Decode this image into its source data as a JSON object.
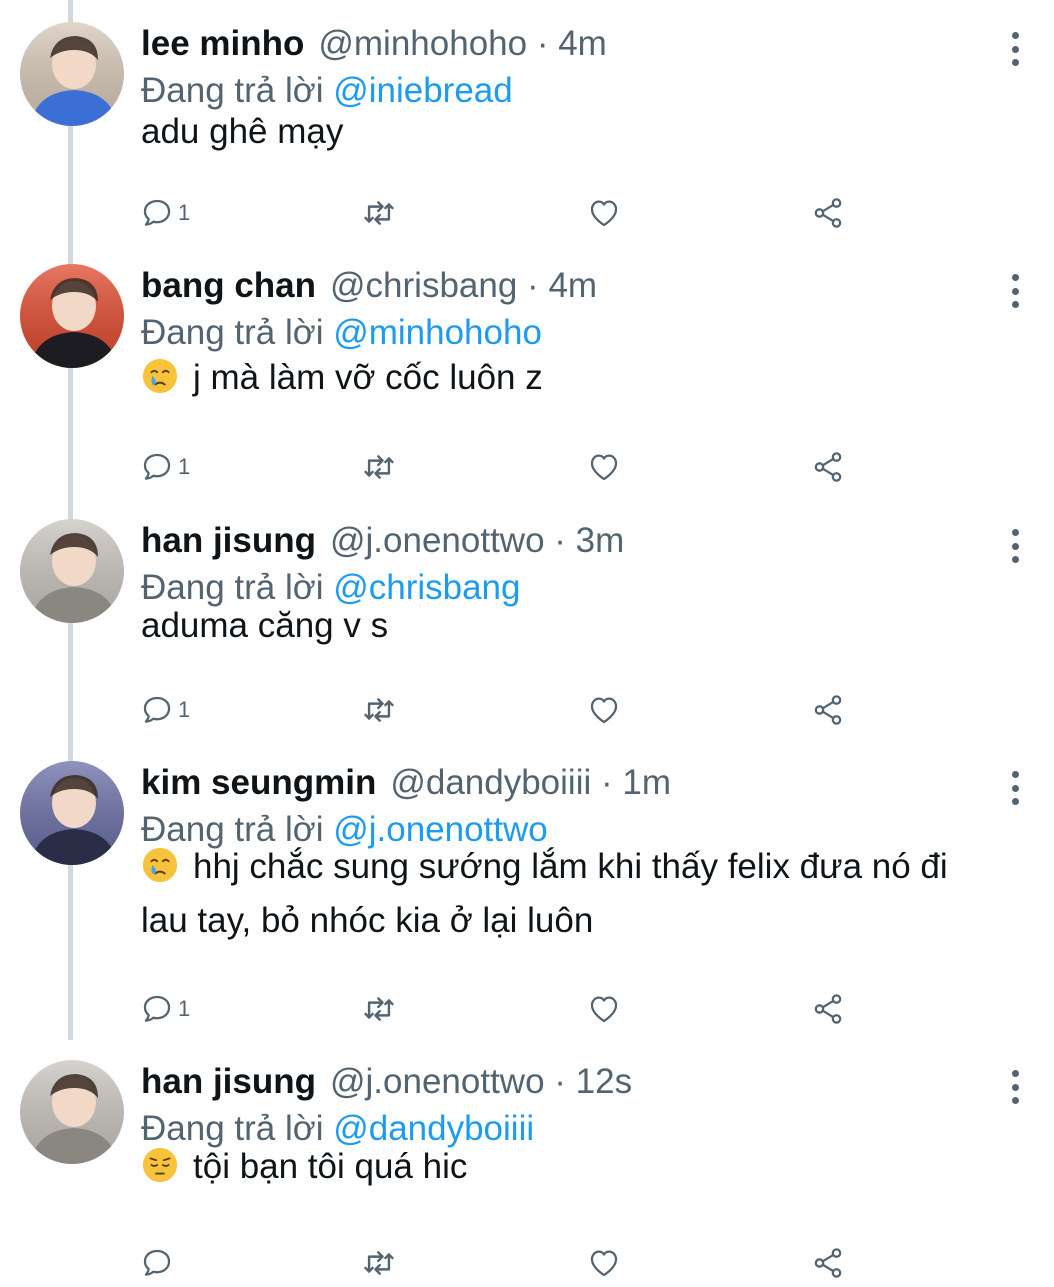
{
  "reply_prefix": "Đang trả lời",
  "colors": {
    "accent": "#1d9bf0",
    "secondary_text": "#536471",
    "primary_text": "#0f1419",
    "thread_line": "#cfd9de"
  },
  "tweets": [
    {
      "display_name": "lee minho",
      "handle": "@minhohoho",
      "time": "4m",
      "reply_to": "@iniebread",
      "emoji": "",
      "text": "adu ghê mạy",
      "reply_count": "1",
      "avatar_colors": [
        "#d7c8b8",
        "#3b6fd6"
      ]
    },
    {
      "display_name": "bang chan",
      "handle": "@chrisbang",
      "time": "4m",
      "reply_to": "@minhohoho",
      "emoji": "crying-face",
      "text": "j mà làm vỡ cốc luôn z",
      "reply_count": "1",
      "avatar_colors": [
        "#e04a2e",
        "#1c1c22"
      ]
    },
    {
      "display_name": "han jisung",
      "handle": "@j.onenottwo",
      "time": "3m",
      "reply_to": "@chrisbang",
      "emoji": "",
      "text": "aduma căng v s",
      "reply_count": "1",
      "avatar_colors": [
        "#c9c4bf",
        "#8a8680"
      ]
    },
    {
      "display_name": "kim seungmin",
      "handle": "@dandyboiiii",
      "time": "1m",
      "reply_to": "@j.onenottwo",
      "emoji": "crying-face",
      "text": "hhj chắc sung sướng lắm khi thấy felix đưa nó đi lau tay, bỏ nhóc kia ở lại luôn",
      "reply_count": "1",
      "avatar_colors": [
        "#6a6fa6",
        "#2a2d45"
      ]
    },
    {
      "display_name": "han jisung",
      "handle": "@j.onenottwo",
      "time": "12s",
      "reply_to": "@dandyboiiii",
      "emoji": "pensive-face",
      "text": "tội bạn tôi quá hic",
      "reply_count": "",
      "avatar_colors": [
        "#c9c4bf",
        "#8a8680"
      ]
    }
  ],
  "icons": [
    "reply-icon",
    "retweet-icon",
    "like-icon",
    "share-icon",
    "more-icon"
  ]
}
